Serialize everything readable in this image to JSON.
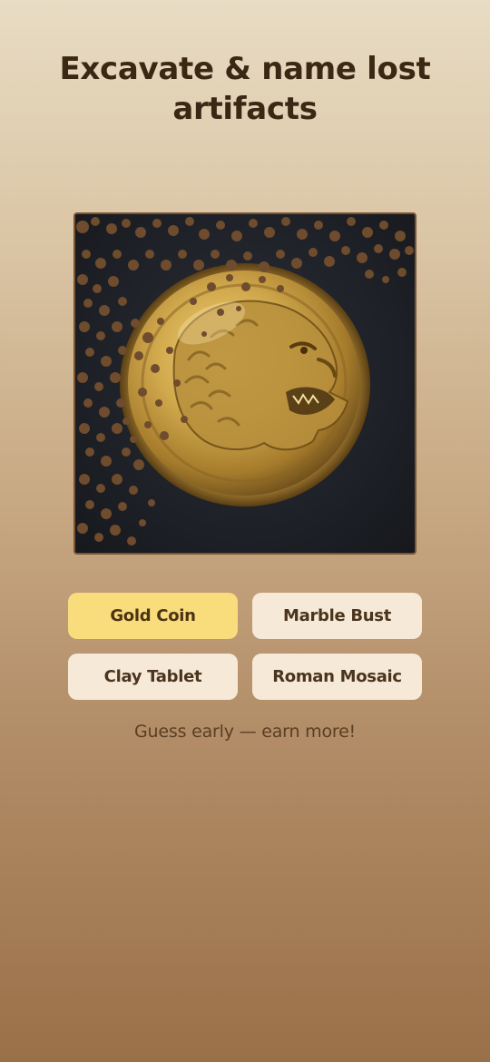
{
  "header": {
    "title": "Excavate & name lost artifacts"
  },
  "dig_site": {
    "artifact_icon": "gold-coin-lion-icon",
    "colors": {
      "background": "#1e2127",
      "dirt": "#6e4c2d",
      "gold": "#c9a24a"
    }
  },
  "answers": {
    "options": [
      {
        "label": "Gold Coin",
        "selected": true
      },
      {
        "label": "Marble Bust",
        "selected": false
      },
      {
        "label": "Clay Tablet",
        "selected": false
      },
      {
        "label": "Roman Mosaic",
        "selected": false
      }
    ]
  },
  "footer": {
    "hint": "Guess early — earn more!"
  },
  "theme": {
    "accent_selected": "#f9dc7c",
    "button_bg": "#f6e9d8",
    "title_color": "#3b2814"
  }
}
